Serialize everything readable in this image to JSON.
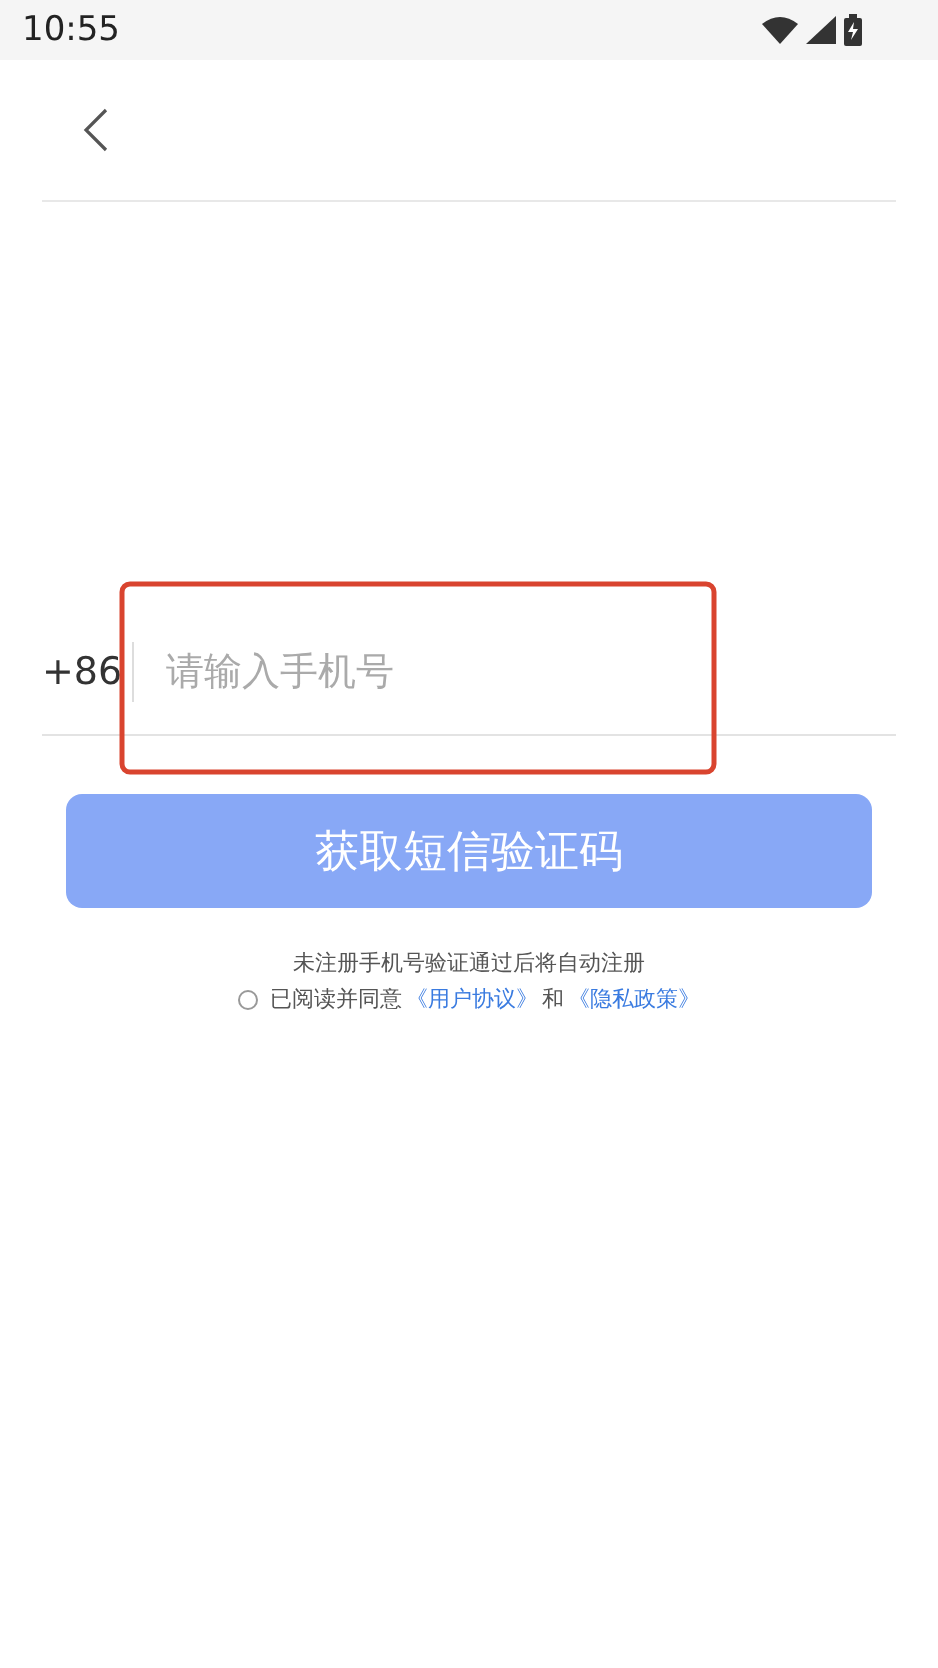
{
  "status_bar": {
    "time": "10:55"
  },
  "phone_field": {
    "prefix": "+86",
    "placeholder": "请输入手机号"
  },
  "submit_button": {
    "label": "获取短信验证码",
    "disabled": true
  },
  "notice": "未注册手机号验证通过后将自动注册",
  "agreement": {
    "checked": false,
    "parts": [
      {
        "kind": "text",
        "text": "已阅读并同意"
      },
      {
        "kind": "link",
        "text": "《用户协议》"
      },
      {
        "kind": "text",
        "text": "和"
      },
      {
        "kind": "link",
        "text": "《隐私政策》"
      }
    ]
  }
}
